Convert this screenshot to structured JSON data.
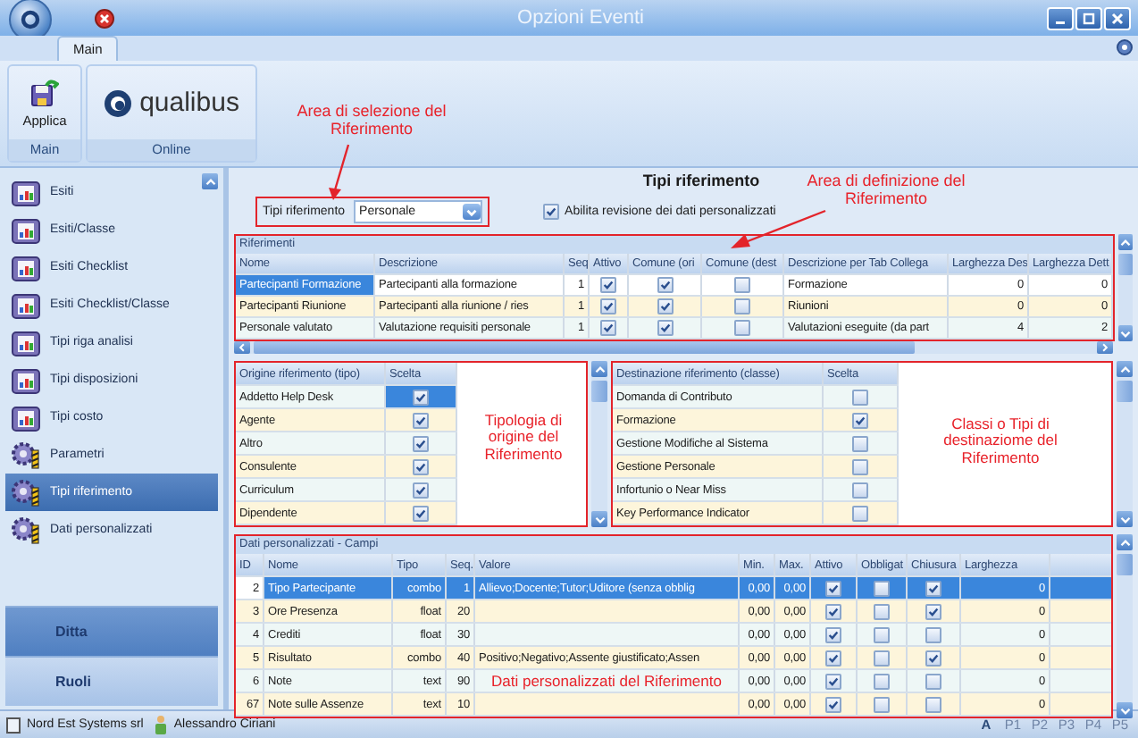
{
  "window": {
    "title": "Opzioni Eventi"
  },
  "ribbon": {
    "tabs": [
      {
        "label": "Main",
        "selected": true
      }
    ],
    "apply_button": "Applica",
    "main_group": "Main",
    "logo_text": "qualibus",
    "online_group": "Online"
  },
  "sidebar": {
    "items": [
      {
        "label": "Esiti",
        "kind": "report",
        "selected": false
      },
      {
        "label": "Esiti/Classe",
        "kind": "report",
        "selected": false
      },
      {
        "label": "Esiti Checklist",
        "kind": "report",
        "selected": false
      },
      {
        "label": "Esiti Checklist/Classe",
        "kind": "report",
        "selected": false
      },
      {
        "label": "Tipi riga analisi",
        "kind": "report",
        "selected": false
      },
      {
        "label": "Tipi disposizioni",
        "kind": "report",
        "selected": false
      },
      {
        "label": "Tipi costo",
        "kind": "report",
        "selected": false
      },
      {
        "label": "Parametri",
        "kind": "gear",
        "selected": false
      },
      {
        "label": "Tipi riferimento",
        "kind": "gear",
        "selected": true
      },
      {
        "label": "Dati personalizzati",
        "kind": "gear",
        "selected": false
      }
    ],
    "nav_buttons": [
      {
        "label": "Ditta",
        "selected": true
      },
      {
        "label": "Ruoli",
        "selected": false
      }
    ]
  },
  "content": {
    "title": "Tipi riferimento",
    "selector": {
      "label": "Tipi riferimento",
      "value": "Personale"
    },
    "revision_checkbox": {
      "label": "Abilita revisione dei dati personalizzati",
      "checked": true
    }
  },
  "references": {
    "caption": "Riferimenti",
    "columns": [
      {
        "label": "Nome",
        "kind": "text"
      },
      {
        "label": "Descrizione",
        "kind": "text"
      },
      {
        "label": "Seq",
        "kind": "number"
      },
      {
        "label": "Attivo",
        "kind": "check"
      },
      {
        "label": "Comune (ori",
        "kind": "check"
      },
      {
        "label": "Comune (dest",
        "kind": "check"
      },
      {
        "label": "Descrizione per Tab Collega",
        "kind": "text"
      },
      {
        "label": "Larghezza Des",
        "kind": "number"
      },
      {
        "label": "Larghezza Dett",
        "kind": "number"
      }
    ],
    "rows": [
      {
        "selected": true,
        "cells": [
          "Partecipanti Formazione",
          "Partecipanti alla formazione",
          "1",
          true,
          true,
          false,
          "Formazione",
          "0",
          "0"
        ]
      },
      {
        "selected": false,
        "cells": [
          "Partecipanti Riunione",
          "Partecipanti alla riunione / ries",
          "1",
          true,
          true,
          false,
          "Riunioni",
          "0",
          "0"
        ]
      },
      {
        "selected": false,
        "cells": [
          "Personale valutato",
          "Valutazione requisiti personale",
          "1",
          true,
          true,
          false,
          "Valutazioni eseguite (da part",
          "4",
          "2"
        ]
      }
    ]
  },
  "origins": {
    "columns": [
      "Origine riferimento (tipo)",
      "Scelta"
    ],
    "rows": [
      {
        "label": "Addetto Help Desk",
        "checked": true,
        "selected": true
      },
      {
        "label": "Agente",
        "checked": true,
        "selected": false
      },
      {
        "label": "Altro",
        "checked": true,
        "selected": false
      },
      {
        "label": "Consulente",
        "checked": true,
        "selected": false
      },
      {
        "label": "Curriculum",
        "checked": true,
        "selected": false
      },
      {
        "label": "Dipendente",
        "checked": true,
        "selected": false
      }
    ]
  },
  "destinations": {
    "columns": [
      "Destinazione riferimento (classe)",
      "Scelta"
    ],
    "rows": [
      {
        "label": "Domanda di Contributo",
        "checked": false,
        "selected": false
      },
      {
        "label": "Formazione",
        "checked": true,
        "selected": false
      },
      {
        "label": "Gestione Modifiche al Sistema",
        "checked": false,
        "selected": false
      },
      {
        "label": "Gestione Personale",
        "checked": false,
        "selected": false
      },
      {
        "label": "Infortunio o Near Miss",
        "checked": false,
        "selected": false
      },
      {
        "label": "Key Performance Indicator",
        "checked": false,
        "selected": false
      }
    ]
  },
  "custom_fields": {
    "caption": "Dati personalizzati - Campi",
    "columns": [
      {
        "label": "ID",
        "kind": "number"
      },
      {
        "label": "Nome",
        "kind": "text"
      },
      {
        "label": "Tipo",
        "kind": "number"
      },
      {
        "label": "Seq.",
        "kind": "number"
      },
      {
        "label": "Valore",
        "kind": "text"
      },
      {
        "label": "Min.",
        "kind": "number"
      },
      {
        "label": "Max.",
        "kind": "number"
      },
      {
        "label": "Attivo",
        "kind": "check"
      },
      {
        "label": "Obbligat",
        "kind": "check"
      },
      {
        "label": "Chiusura",
        "kind": "check"
      },
      {
        "label": "Larghezza",
        "kind": "number"
      }
    ],
    "rows": [
      {
        "selected": true,
        "cells": [
          "2",
          "Tipo Partecipante",
          "combo",
          "1",
          "Allievo;Docente;Tutor;Uditore (senza obblig",
          "0,00",
          "0,00",
          true,
          false,
          true,
          "0"
        ]
      },
      {
        "selected": false,
        "cells": [
          "3",
          "Ore Presenza",
          "float",
          "20",
          null,
          "0,00",
          "0,00",
          true,
          false,
          true,
          "0"
        ]
      },
      {
        "selected": false,
        "cells": [
          "4",
          "Crediti",
          "float",
          "30",
          null,
          "0,00",
          "0,00",
          true,
          false,
          false,
          "0"
        ]
      },
      {
        "selected": false,
        "cells": [
          "5",
          "Risultato",
          "combo",
          "40",
          "Positivo;Negativo;Assente giustificato;Assen",
          "0,00",
          "0,00",
          true,
          false,
          true,
          "0"
        ]
      },
      {
        "selected": false,
        "cells": [
          "6",
          "Note",
          "text",
          "90",
          null,
          "0,00",
          "0,00",
          true,
          false,
          false,
          "0"
        ]
      },
      {
        "selected": false,
        "cells": [
          "67",
          "Note sulle Assenze",
          "text",
          "10",
          null,
          "0,00",
          "0,00",
          true,
          false,
          false,
          "0"
        ]
      }
    ]
  },
  "annotations": [
    {
      "text": "Area di selezione del Riferimento"
    },
    {
      "text": "Area di definizione del Riferimento"
    },
    {
      "text": "Tipologia di origine del Riferimento"
    },
    {
      "text": "Classi o Tipi di destinaziome del Riferimento"
    },
    {
      "text": "Dati personalizzati del Riferimento"
    }
  ],
  "status_bar": {
    "company": "Nord Est Systems srl",
    "user": "Alessandro Ciriani",
    "keys": [
      {
        "label": "A",
        "disabled": false
      },
      {
        "label": "P1",
        "disabled": true
      },
      {
        "label": "P2",
        "disabled": true
      },
      {
        "label": "P3",
        "disabled": true
      },
      {
        "label": "P4",
        "disabled": true
      },
      {
        "label": "P5",
        "disabled": true
      }
    ]
  }
}
